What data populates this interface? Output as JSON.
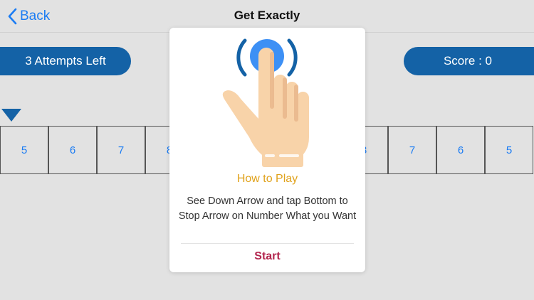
{
  "nav": {
    "back_label": "Back",
    "title": "Get Exactly"
  },
  "status": {
    "attempts_label": "3 Attempts Left",
    "score_label": "Score : 0"
  },
  "cells": [
    "5",
    "6",
    "7",
    "8",
    "",
    "",
    "",
    "8",
    "7",
    "6",
    "5"
  ],
  "modal": {
    "title": "How to Play",
    "text": "See Down Arrow and tap Bottom to Stop Arrow on Number What you Want",
    "start_label": "Start"
  },
  "colors": {
    "accent_blue": "#1462a6",
    "link_blue": "#1b7cf3",
    "title_gold": "#e0a21c",
    "start_red": "#b3264e",
    "background": "#e2e2e2"
  },
  "icons": {
    "illustration": "tap-hand-icon",
    "back": "chevron-left-icon",
    "marker": "down-arrow-icon"
  }
}
